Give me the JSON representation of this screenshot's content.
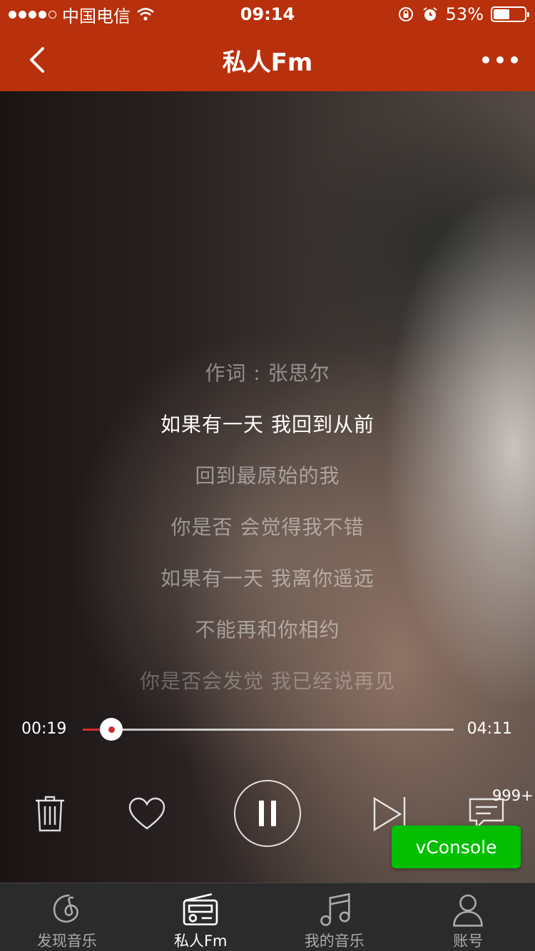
{
  "status_bar": {
    "carrier": "中国电信",
    "time": "09:14",
    "battery_percent": "53%",
    "battery_level": 0.53,
    "signal_bars": 4
  },
  "nav": {
    "title": "私人Fm",
    "back_icon": "chevron-left-icon",
    "more_icon": "more-dots-icon"
  },
  "lyrics": [
    {
      "text": "作词 : 张思尔",
      "state": "normal"
    },
    {
      "text": "如果有一天 我回到从前",
      "state": "current"
    },
    {
      "text": "回到最原始的我",
      "state": "normal"
    },
    {
      "text": "你是否 会觉得我不错",
      "state": "normal"
    },
    {
      "text": "如果有一天 我离你遥远",
      "state": "normal"
    },
    {
      "text": "不能再和你相约",
      "state": "normal"
    },
    {
      "text": "你是否会发觉 我已经说再见",
      "state": "faded"
    }
  ],
  "progress": {
    "current": "00:19",
    "total": "04:11",
    "fraction": 0.076
  },
  "controls": {
    "comment_count": "999+",
    "accent": "#d32c2c"
  },
  "vconsole": {
    "label": "vConsole"
  },
  "tabs": [
    {
      "label": "发现音乐",
      "icon": "netease-music-icon",
      "active": false
    },
    {
      "label": "私人Fm",
      "icon": "radio-icon",
      "active": true
    },
    {
      "label": "我的音乐",
      "icon": "music-note-icon",
      "active": false
    },
    {
      "label": "账号",
      "icon": "user-icon",
      "active": false
    }
  ],
  "colors": {
    "brand": "#b9300c",
    "tabbar": "#2b2b2b",
    "vconsole": "#04be02"
  }
}
